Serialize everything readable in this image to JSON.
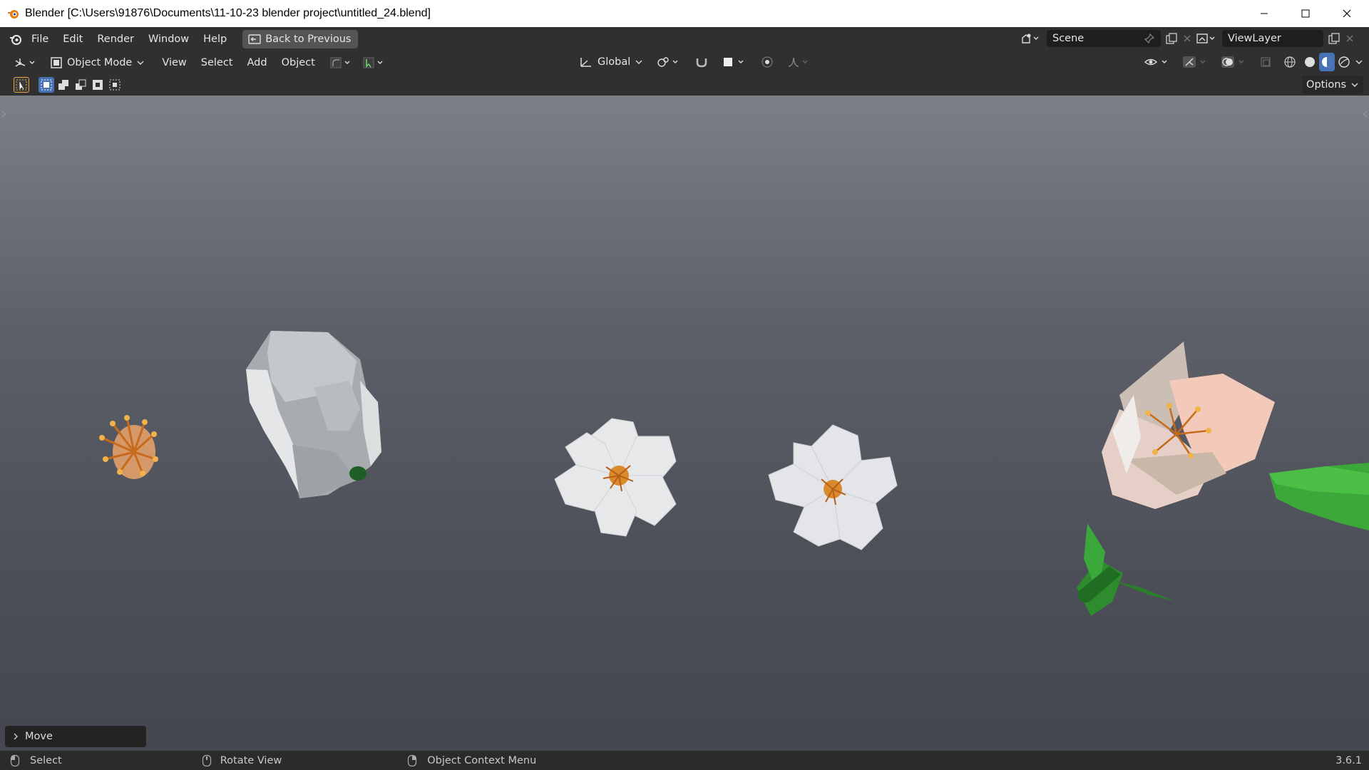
{
  "window": {
    "title": "Blender [C:\\Users\\91876\\Documents\\11-10-23 blender project\\untitled_24.blend]"
  },
  "topbar": {
    "menu": [
      "File",
      "Edit",
      "Render",
      "Window",
      "Help"
    ],
    "back_button": "Back to Previous",
    "scene_name": "Scene",
    "view_layer": "ViewLayer"
  },
  "header": {
    "mode": "Object Mode",
    "menus": [
      "View",
      "Select",
      "Add",
      "Object"
    ],
    "transform_orientation": "Global"
  },
  "toolbar": {
    "options_label": "Options"
  },
  "viewport": {
    "last_operator": "Move"
  },
  "statusbar": {
    "select": "Select",
    "rotate_view": "Rotate View",
    "context_menu": "Object Context Menu",
    "version": "3.6.1"
  },
  "colors": {
    "accent_active": "#4772b3",
    "header_bg": "#303030",
    "active_tool_outline": "#e8a33c"
  }
}
